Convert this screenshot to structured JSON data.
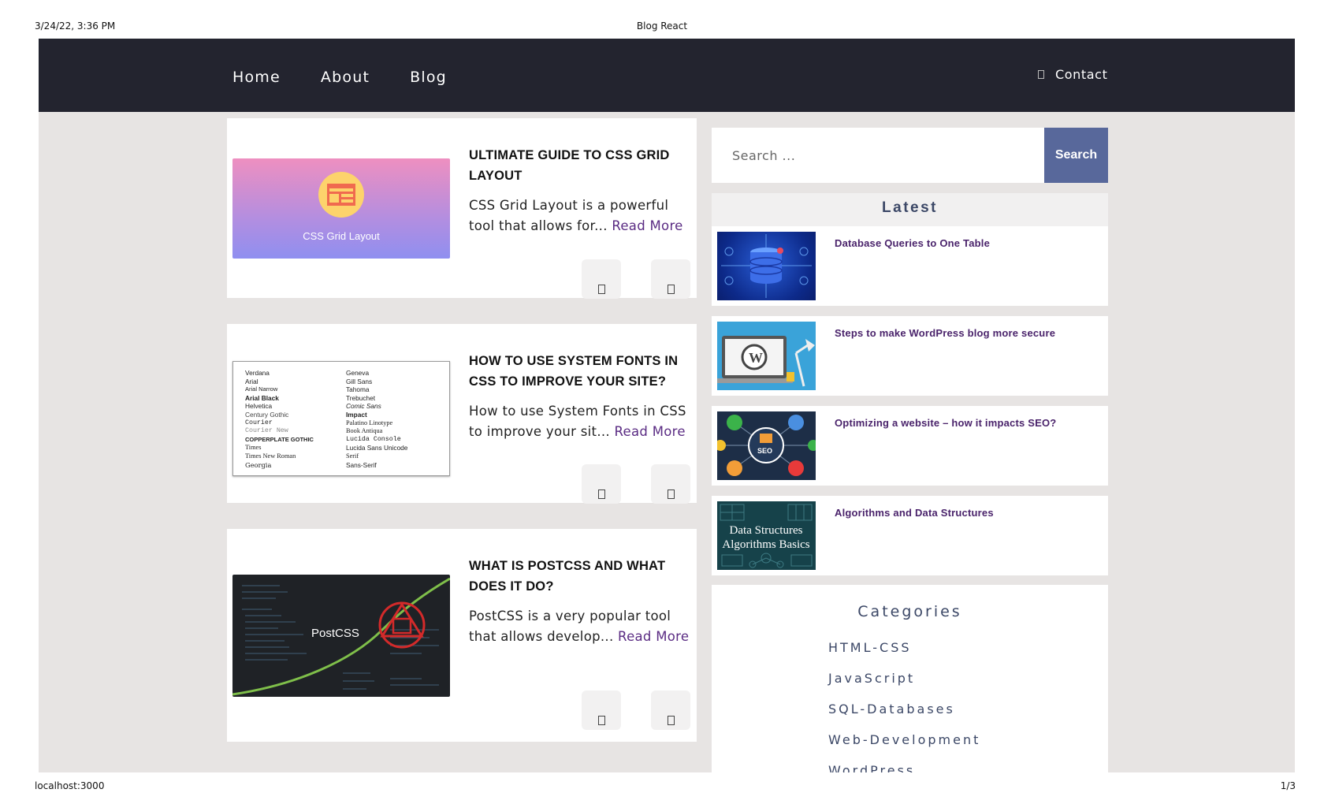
{
  "print": {
    "date": "3/24/22, 3:36 PM",
    "title": "Blog React",
    "url": "localhost:3000",
    "page": "1/3"
  },
  "nav": {
    "links": [
      "Home",
      "About",
      "Blog"
    ],
    "contact": "Contact"
  },
  "posts": [
    {
      "title": "ULTIMATE GUIDE TO CSS GRID LAYOUT",
      "excerpt": "CSS Grid Layout is a powerful tool that allows for...",
      "read_more": "Read More",
      "thumb_caption": "CSS Grid Layout"
    },
    {
      "title": "HOW TO USE SYSTEM FONTS IN CSS TO IMPROVE YOUR SITE?",
      "excerpt": "How to use System Fonts in CSS to improve your sit...",
      "read_more": "Read More",
      "fonts_left": [
        "Verdana",
        "Arial",
        "Arial Narrow",
        "Arial Black",
        "Helvetica",
        "Century Gothic",
        "Courier",
        "Courier New",
        "COPPERPLATE GOTHIC",
        "Times",
        "Times New Roman",
        "Georgia"
      ],
      "fonts_right": [
        "Geneva",
        "Gill Sans",
        "Tahoma",
        "Trebuchet",
        "Comic Sans",
        "Impact",
        "Palatino Linotype",
        "Book Antiqua",
        "Lucida Console",
        "Lucida Sans Unicode",
        "Serif",
        "Sans-Serif"
      ]
    },
    {
      "title": "WHAT IS POSTCSS AND WHAT DOES IT DO?",
      "excerpt": "PostCSS is a very popular tool that allows develop...",
      "read_more": "Read More",
      "thumb_caption": "PostCSS"
    }
  ],
  "search": {
    "placeholder": "Search ...",
    "button": "Search"
  },
  "latest": {
    "heading": "Latest",
    "items": [
      {
        "title": "Database Queries to One Table",
        "thumb_icon": "database-icon"
      },
      {
        "title": "Steps to make WordPress blog more secure",
        "thumb_icon": "wordpress-icon"
      },
      {
        "title": "Optimizing a website – how it impacts SEO?",
        "thumb_icon": "seo-icon",
        "thumb_text": "SEO"
      },
      {
        "title": "Algorithms and Data Structures",
        "thumb_text_1": "Data Structures",
        "thumb_text_2": "Algorithms Basics"
      }
    ]
  },
  "categories": {
    "heading": "Categories",
    "items": [
      "HTML-CSS",
      "JavaScript",
      "SQL-Databases",
      "Web-Development",
      "WordPress"
    ]
  },
  "colors": {
    "navbar": "#23242f",
    "page_bg": "#e7e4e3",
    "search_button": "#58689b",
    "link": "#5a2b83",
    "heading_blue": "#3b4766"
  }
}
